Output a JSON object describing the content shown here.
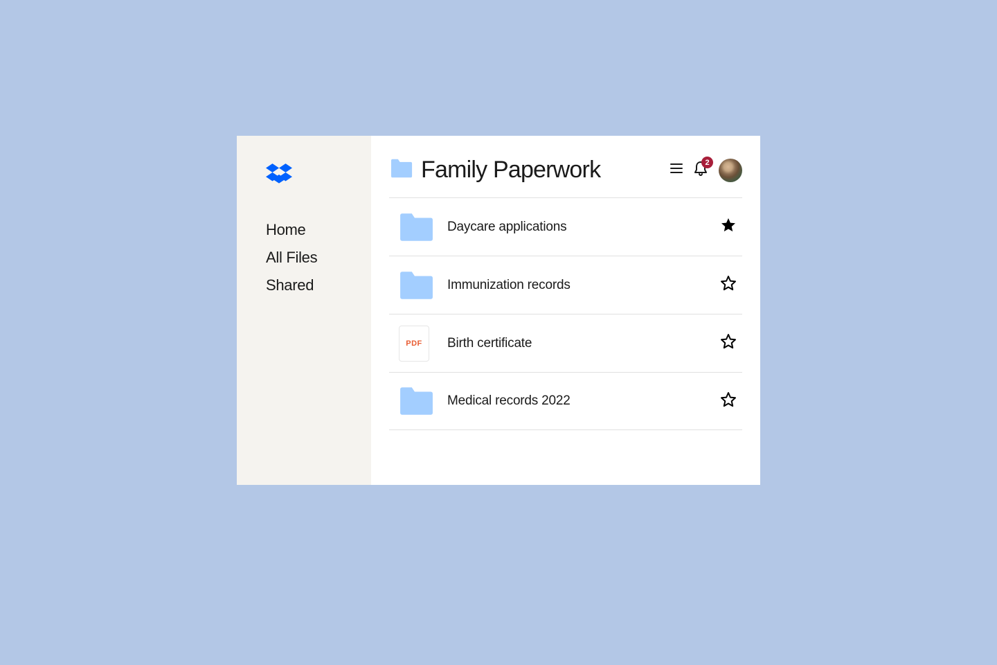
{
  "sidebar": {
    "items": [
      {
        "label": "Home"
      },
      {
        "label": "All Files"
      },
      {
        "label": "Shared"
      }
    ]
  },
  "header": {
    "title": "Family Paperwork",
    "notification_count": "2"
  },
  "files": [
    {
      "name": "Daycare applications",
      "type": "folder",
      "starred": true
    },
    {
      "name": "Immunization records",
      "type": "folder",
      "starred": false
    },
    {
      "name": "Birth certificate",
      "type": "pdf",
      "starred": false
    },
    {
      "name": "Medical records 2022",
      "type": "folder",
      "starred": false
    }
  ],
  "pdf_label": "PDF",
  "colors": {
    "folder": "#a3ceff",
    "accent": "#0061fe",
    "badge": "#a81e3a"
  }
}
